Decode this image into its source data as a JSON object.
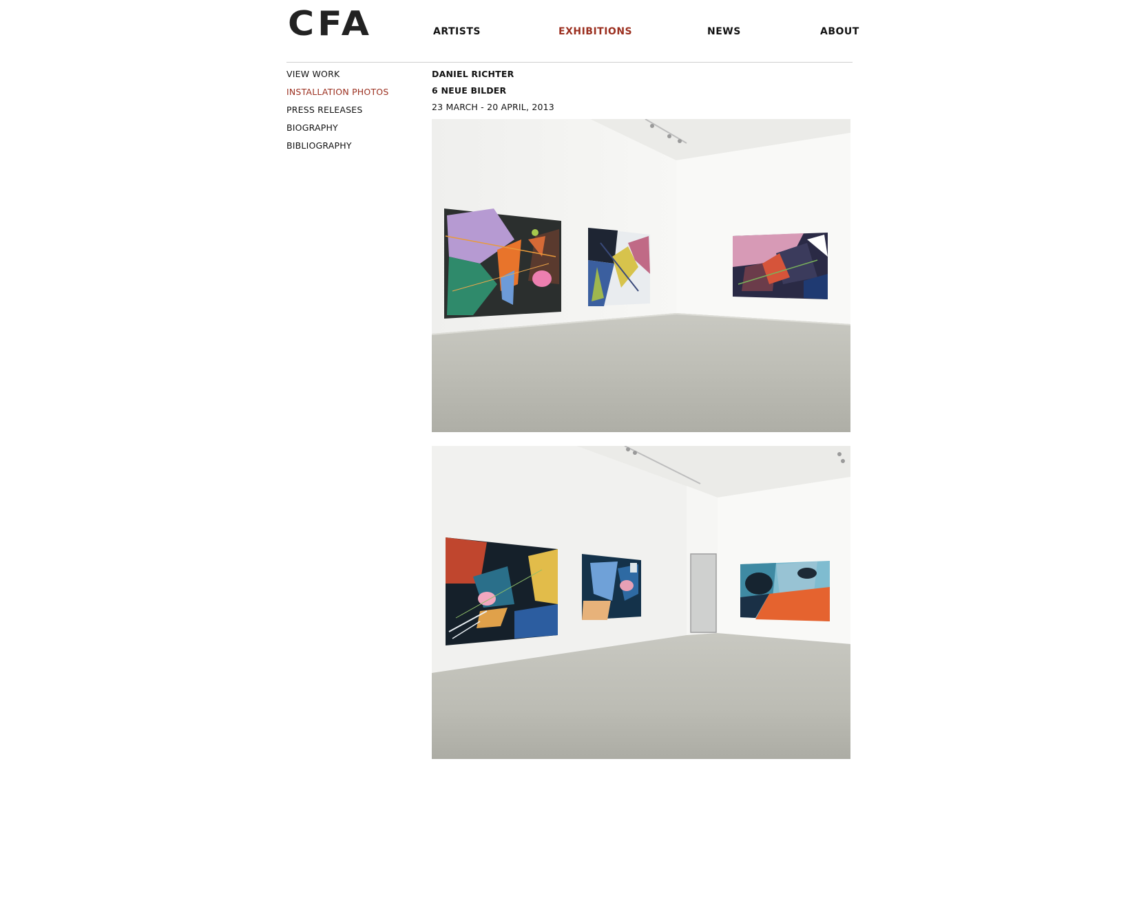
{
  "logo": {
    "text": "CFA"
  },
  "topnav": {
    "items": [
      {
        "label": "ARTISTS"
      },
      {
        "label": "EXHIBITIONS",
        "active": true
      },
      {
        "label": "NEWS"
      },
      {
        "label": "ABOUT"
      }
    ],
    "active_color": "#9b2f1f"
  },
  "sidenav": {
    "items": [
      {
        "label": "VIEW WORK"
      },
      {
        "label": "INSTALLATION PHOTOS",
        "active": true
      },
      {
        "label": "PRESS RELEASES"
      },
      {
        "label": "BIOGRAPHY"
      },
      {
        "label": "BIBLIOGRAPHY"
      }
    ]
  },
  "exhibition": {
    "artist": "DANIEL RICHTER",
    "title": "6 NEUE BILDER",
    "dates": "23 MARCH - 20 APRIL, 2013"
  },
  "photos": [
    {
      "subject": "gallery-installation-view"
    },
    {
      "subject": "gallery-installation-view"
    }
  ]
}
